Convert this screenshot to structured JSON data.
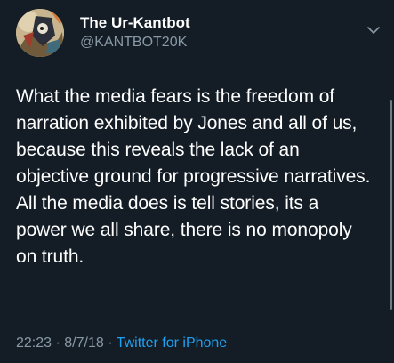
{
  "tweet": {
    "display_name": "The Ur-Kantbot",
    "handle": "@KANTBOT20K",
    "text": "What the media fears is the freedom of narration exhibited by Jones and all of us, because this reveals the lack of an objective ground for progressive narratives. All the media does is tell stories, its a power we all share, there is no monopoly on truth.",
    "time": "22:23",
    "date": "8/7/18",
    "separator": "·",
    "source": "Twitter for iPhone"
  },
  "icons": {
    "caret": "chevron-down-icon",
    "avatar": "avatar"
  },
  "colors": {
    "background": "#141d26",
    "primary_text": "#ffffff",
    "secondary_text": "#8899a6",
    "link": "#1da1f2"
  }
}
